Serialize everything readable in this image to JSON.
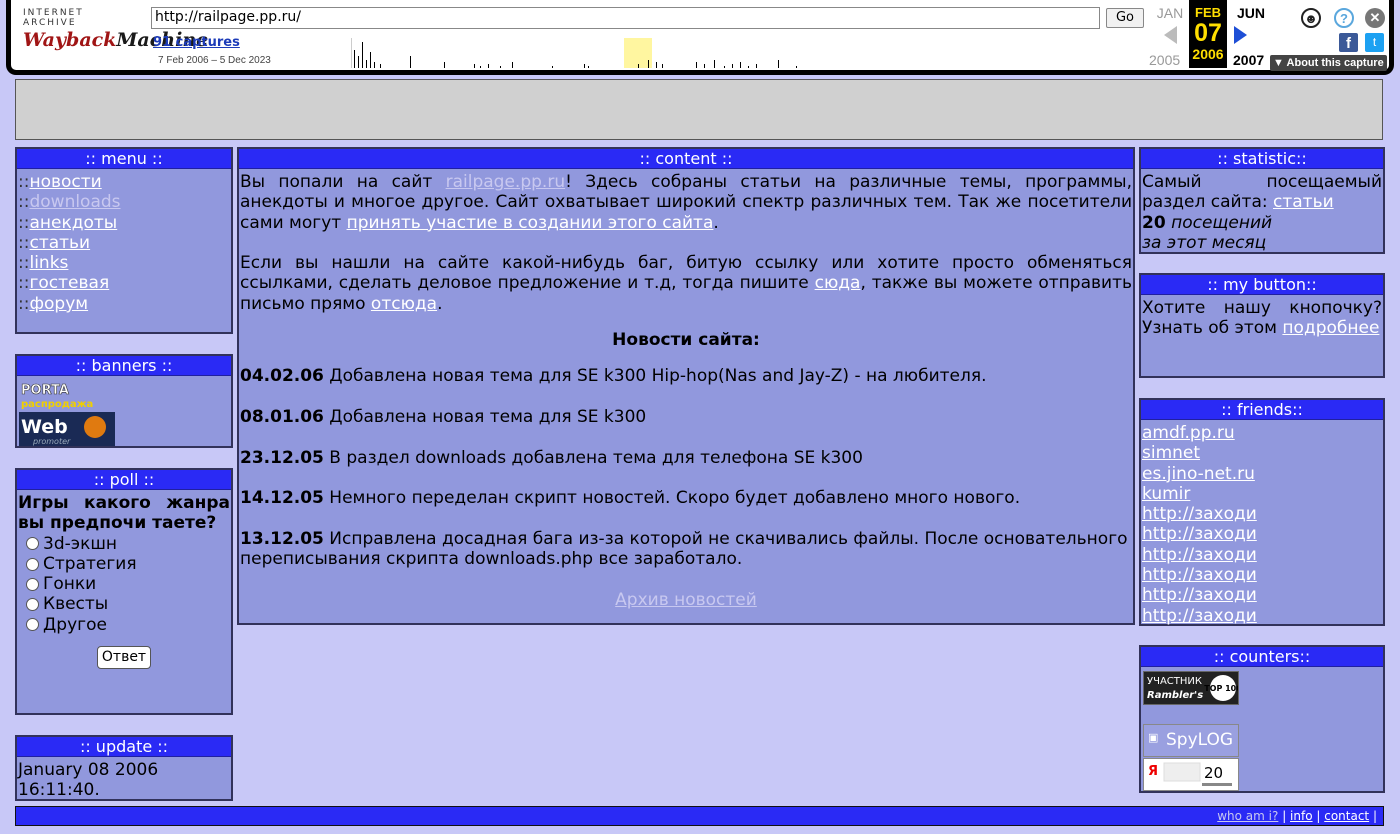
{
  "wayback": {
    "logo_small": "INTERNET ARCHIVE",
    "logo_wayback": "Wayback",
    "logo_machine": "Machine",
    "url": "http://railpage.pp.ru/",
    "go_label": "Go",
    "captures": "91 captures",
    "range": "7 Feb 2006 – 5 Dec 2023",
    "month_prev": "JAN",
    "month_cur": "FEB",
    "month_next": "JUN",
    "day_cur": "07",
    "year_prev": "2005",
    "year_cur": "2006",
    "year_next": "2007",
    "help_glyph": "?",
    "close_glyph": "✕",
    "user_glyph": "☻",
    "fb_glyph": "f",
    "tw_glyph": "t",
    "about": "▼ About this capture"
  },
  "menu": {
    "header": ":: menu ::",
    "sep": "::",
    "items": [
      "новости",
      "downloads",
      "анекдоты",
      "статьи",
      "links",
      "гостевая",
      "форум"
    ]
  },
  "banners": {
    "header": ":: banners ::",
    "porta_text": "PORTA",
    "porta_sub": "распродажа",
    "web_text": "Web",
    "web_sub": "promoter"
  },
  "poll": {
    "header": ":: poll ::",
    "question": "Игры какого жанра вы предпочи таете?",
    "options": [
      "3d-экшн",
      "Стратегия",
      "Гонки",
      "Квесты",
      "Другое"
    ],
    "submit": "Ответ"
  },
  "update": {
    "header": ":: update ::",
    "line1": "January 08 2006",
    "line2": "16:11:40."
  },
  "content": {
    "header": ":: content ::",
    "intro_1": "Вы попали на сайт ",
    "intro_link": "railpage.pp.ru",
    "intro_2": "! Здесь собраны статьи на различные темы, программы, анекдоты и многое другое. Сайт охватывает широкий спектр различных тем. Так же посетители сами могут ",
    "intro_link2": "принять участие в создании этого сайта",
    "intro_3": ".",
    "contact_1": "Если вы нашли на сайте какой-нибудь баг, битую ссылку или хотите просто обменяться ссылками, сделать деловое предложение и т.д, тогда пишите ",
    "contact_link1": "сюда",
    "contact_2": ", также вы можете отправить письмо прямо ",
    "contact_link2": "отсюда",
    "contact_3": ".",
    "news_title": "Новости сайта:",
    "news": [
      {
        "date": "04.02.06",
        "text": " Добавлена новая тема для SE k300 Hip-hop(Nas and Jay-Z) - на любителя."
      },
      {
        "date": "08.01.06",
        "text": " Добавлена новая тема для SE k300"
      },
      {
        "date": "23.12.05",
        "text": " В раздел downloads добавлена тема для телефона SE k300"
      },
      {
        "date": "14.12.05",
        "text": " Немного переделан скрипт новостей. Скоро будет добавлено много нового."
      },
      {
        "date": "13.12.05",
        "text": " Исправлена досадная бага из-за которой не скачивались файлы. После основательного переписывания скрипта downloads.php все заработало."
      }
    ],
    "archive": "Архив новостей"
  },
  "statistic": {
    "header": ":: statistic::",
    "line1": "Самый посещаемый раздел сайта: ",
    "link": " статьи",
    "count": "20",
    "visits": " посещений",
    "period": "за этот месяц"
  },
  "mybutton": {
    "header": ":: my button::",
    "text": "Хотите нашу кнопочку? Узнать об этом ",
    "link": "подробнее"
  },
  "friends": {
    "header": ":: friends::",
    "items": [
      "amdf.pp.ru",
      "simnet",
      "es.jino-net.ru",
      "kumir",
      "http://заходи",
      "http://заходи",
      "http://заходи",
      "http://заходи",
      "http://заходи",
      "http://заходи"
    ]
  },
  "counters": {
    "header": ":: counters::",
    "rambler_1": "УЧАСТНИК",
    "rambler_2": "Rambler's",
    "rambler_3": "TOP 100",
    "spylog": "SpyLOG",
    "ya_letter": "Я",
    "ya_count": "20"
  },
  "footer": {
    "whoami": "who am i?",
    "sep": " | ",
    "info": "info",
    "contact": "contact",
    "end": " |"
  }
}
